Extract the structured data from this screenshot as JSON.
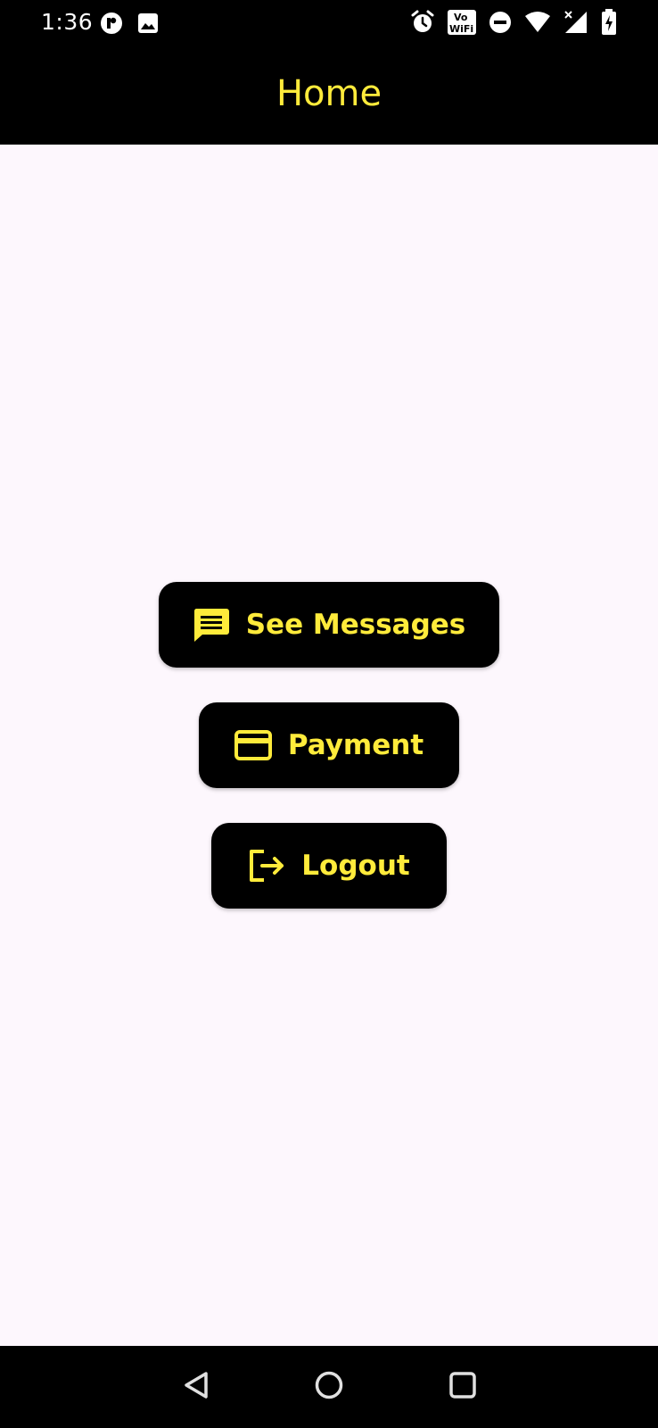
{
  "status_bar": {
    "time": "1:36",
    "left_icons": [
      "app-notification-icon",
      "image-notification-icon"
    ],
    "right_icons": [
      "alarm-icon",
      "vowifi-icon",
      "do-not-disturb-icon",
      "wifi-icon",
      "signal-icon",
      "battery-charging-icon"
    ],
    "vowifi_text_top": "Vo",
    "vowifi_text_bottom": "WiFi"
  },
  "app_bar": {
    "title": "Home"
  },
  "buttons": [
    {
      "label": "See Messages",
      "icon": "message-icon"
    },
    {
      "label": "Payment",
      "icon": "credit-card-icon"
    },
    {
      "label": "Logout",
      "icon": "logout-icon"
    }
  ],
  "nav_bar": {
    "items": [
      "back-icon",
      "home-icon",
      "recents-icon"
    ]
  },
  "colors": {
    "accent": "#ffeb3b",
    "bars": "#000000",
    "background": "#fdf7fd"
  }
}
